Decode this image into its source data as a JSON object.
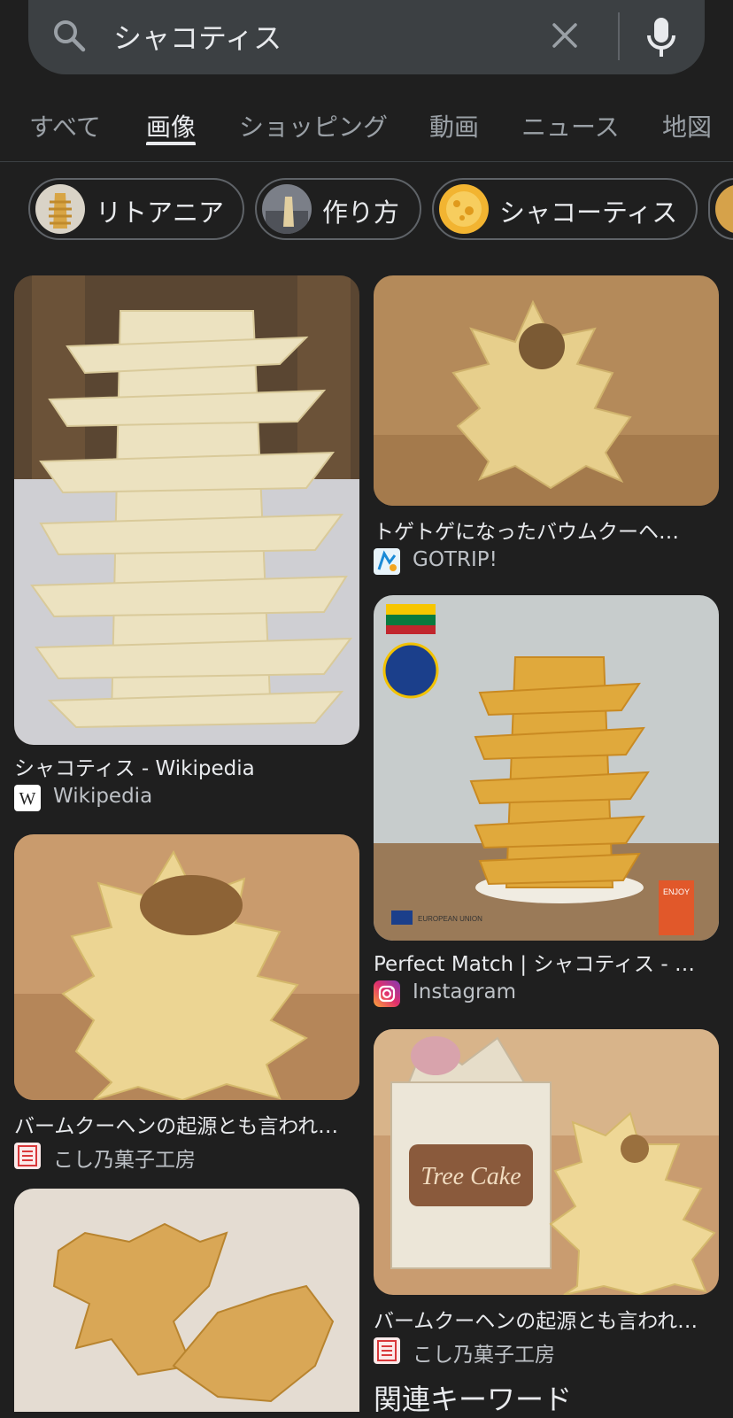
{
  "search": {
    "query": "シャコティス"
  },
  "tabs": [
    "すべて",
    "画像",
    "ショッピング",
    "動画",
    "ニュース",
    "地図"
  ],
  "chips": [
    "リトアニア",
    "作り方",
    "シャコーティス"
  ],
  "results": {
    "r1": {
      "title": "シャコティス - Wikipedia",
      "source": "Wikipedia"
    },
    "r2": {
      "title": "トゲトゲになったバウムクーヘ…",
      "source": "GOTRIP!"
    },
    "r3": {
      "title": "Perfect Match | シャコティス - …",
      "source": "Instagram"
    },
    "r4": {
      "title": "バームクーヘンの起源とも言われ…",
      "source": "こし乃菓子工房"
    },
    "r5": {
      "title": "バームクーヘンの起源とも言われ…",
      "source": "こし乃菓子工房"
    },
    "r6": {
      "image_text": "Tree Cake"
    },
    "r3_labels": {
      "enjoy": "ENJOY",
      "eu": "EUROPEAN UNION"
    }
  },
  "related": {
    "heading": "関連キーワード"
  },
  "colors": {
    "background": "#1f1f1f",
    "searchbar": "#3c4043",
    "text": "#e3e3e3",
    "muted": "#9aa0a6"
  }
}
